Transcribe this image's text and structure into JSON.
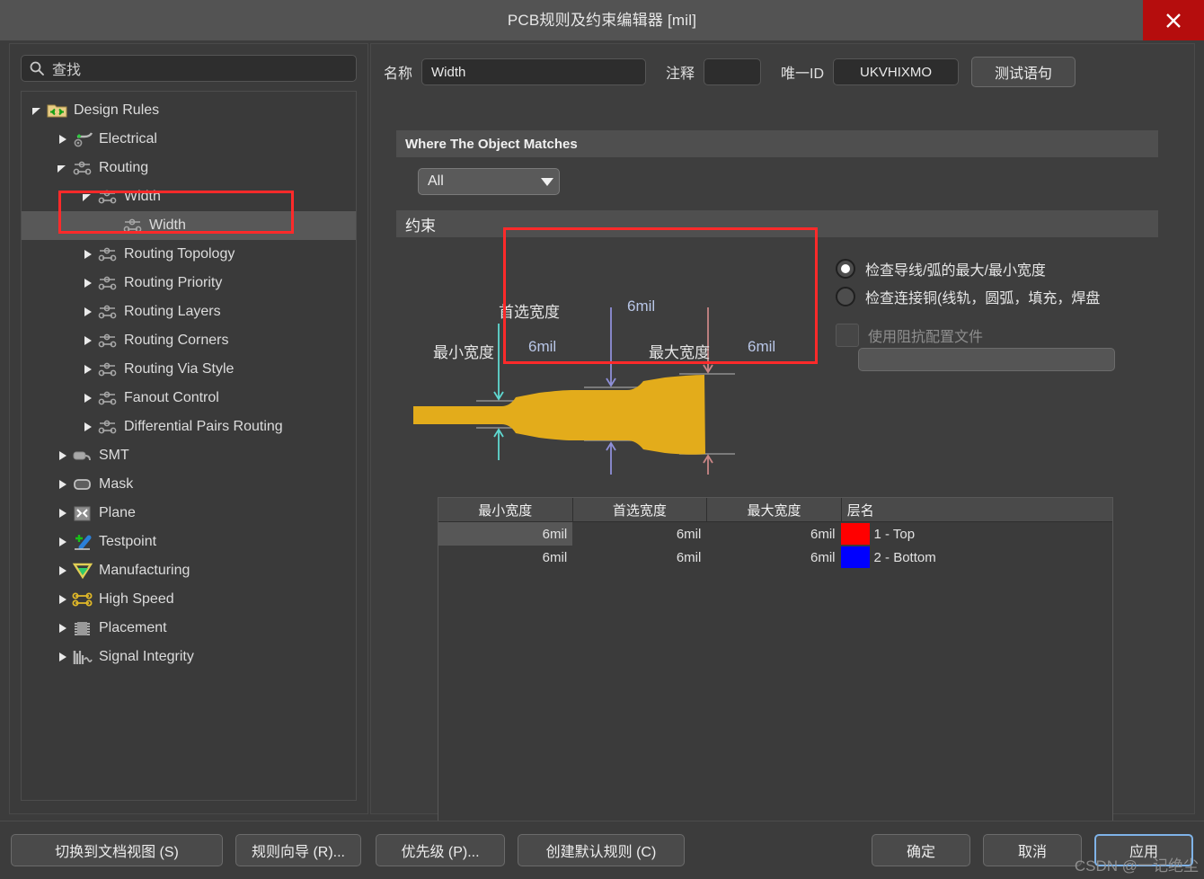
{
  "window": {
    "title": "PCB规则及约束编辑器 [mil]",
    "close_icon": "close-icon"
  },
  "sidebar": {
    "search": {
      "placeholder": "查找",
      "icon": "search-icon"
    },
    "tree": [
      {
        "label": "Design Rules",
        "depth": 0,
        "icon": "folder-rules-icon",
        "expander": "expanded",
        "selected": false
      },
      {
        "label": "Electrical",
        "depth": 1,
        "icon": "electrical-icon",
        "expander": "collapsed",
        "selected": false
      },
      {
        "label": "Routing",
        "depth": 1,
        "icon": "routing-icon",
        "expander": "expanded",
        "selected": false
      },
      {
        "label": "Width",
        "depth": 2,
        "icon": "routing-icon",
        "expander": "expanded",
        "selected": false
      },
      {
        "label": "Width",
        "depth": 3,
        "icon": "routing-icon",
        "expander": "none",
        "selected": true
      },
      {
        "label": "Routing Topology",
        "depth": 2,
        "icon": "routing-icon",
        "expander": "collapsed",
        "selected": false
      },
      {
        "label": "Routing Priority",
        "depth": 2,
        "icon": "routing-icon",
        "expander": "collapsed",
        "selected": false
      },
      {
        "label": "Routing Layers",
        "depth": 2,
        "icon": "routing-icon",
        "expander": "collapsed",
        "selected": false
      },
      {
        "label": "Routing Corners",
        "depth": 2,
        "icon": "routing-icon",
        "expander": "collapsed",
        "selected": false
      },
      {
        "label": "Routing Via Style",
        "depth": 2,
        "icon": "routing-icon",
        "expander": "collapsed",
        "selected": false
      },
      {
        "label": "Fanout Control",
        "depth": 2,
        "icon": "routing-icon",
        "expander": "collapsed",
        "selected": false
      },
      {
        "label": "Differential Pairs Routing",
        "depth": 2,
        "icon": "routing-icon",
        "expander": "collapsed",
        "selected": false
      },
      {
        "label": "SMT",
        "depth": 1,
        "icon": "smt-icon",
        "expander": "collapsed",
        "selected": false
      },
      {
        "label": "Mask",
        "depth": 1,
        "icon": "mask-icon",
        "expander": "collapsed",
        "selected": false
      },
      {
        "label": "Plane",
        "depth": 1,
        "icon": "plane-icon",
        "expander": "collapsed",
        "selected": false
      },
      {
        "label": "Testpoint",
        "depth": 1,
        "icon": "testpoint-icon",
        "expander": "collapsed",
        "selected": false
      },
      {
        "label": "Manufacturing",
        "depth": 1,
        "icon": "manufacturing-icon",
        "expander": "collapsed",
        "selected": false
      },
      {
        "label": "High Speed",
        "depth": 1,
        "icon": "highspeed-icon",
        "expander": "collapsed",
        "selected": false
      },
      {
        "label": "Placement",
        "depth": 1,
        "icon": "placement-icon",
        "expander": "collapsed",
        "selected": false
      },
      {
        "label": "Signal Integrity",
        "depth": 1,
        "icon": "signal-integrity-icon",
        "expander": "collapsed",
        "selected": false
      }
    ]
  },
  "form": {
    "name_label": "名称",
    "name_value": "Width",
    "comment_label": "注释",
    "comment_value": "",
    "uniqueid_label": "唯一ID",
    "uniqueid_value": "UKVHIXMO",
    "test_button": "测试语句"
  },
  "where_section": {
    "header": "Where The Object Matches",
    "scope_value": "All",
    "scope_icon": "chevron-down-icon"
  },
  "constraint_section": {
    "header": "约束",
    "diagram": {
      "min_label": "最小宽度",
      "min_value": "6mil",
      "preferred_label": "首选宽度",
      "preferred_value": "6mil",
      "max_label": "最大宽度",
      "max_value": "6mil",
      "min_arrow_color": "#5fd8d0",
      "preferred_arrow_color": "#8e8fd8",
      "max_arrow_color": "#e08f8f",
      "trace_color": "#e3ac1b"
    },
    "options": {
      "radio1": "检查导线/弧的最大/最小宽度",
      "radio1_selected": true,
      "radio2": "检查连接铜(线轨，圆弧，填充，焊盘",
      "radio2_selected": false,
      "checkbox_label": "使用阻抗配置文件",
      "checkbox_checked": false,
      "checkbox_disabled": true,
      "profile_value": ""
    },
    "table": {
      "columns": [
        "最小宽度",
        "首选宽度",
        "最大宽度",
        "层名"
      ],
      "rows": [
        {
          "min": "6mil",
          "preferred": "6mil",
          "max": "6mil",
          "layer": "1 - Top",
          "swatch": "#ff0000",
          "selected": true
        },
        {
          "min": "6mil",
          "preferred": "6mil",
          "max": "6mil",
          "layer": "2 - Bottom",
          "swatch": "#0000ff",
          "selected": false
        }
      ]
    }
  },
  "footer": {
    "buttons": [
      {
        "label": "切换到文档视图 (S)",
        "focus": false
      },
      {
        "label": "规则向导 (R)...",
        "focus": false
      },
      {
        "label": "优先级 (P)...",
        "focus": false
      },
      {
        "label": "创建默认规则 (C)",
        "focus": false
      },
      {
        "label": "确定",
        "focus": false
      },
      {
        "label": "取消",
        "focus": false
      },
      {
        "label": "应用",
        "focus": true
      }
    ]
  },
  "watermark": "CSDN @一记绝尘"
}
